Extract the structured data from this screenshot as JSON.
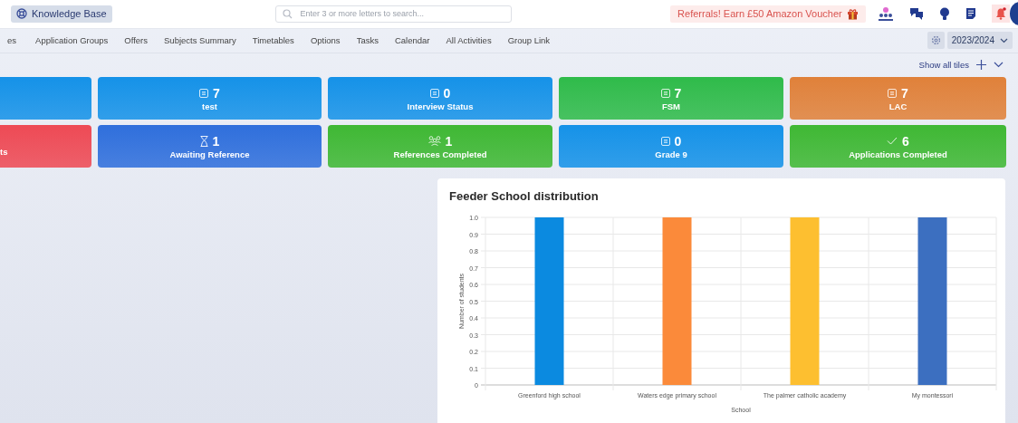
{
  "header": {
    "knowledge_base": "Knowledge Base",
    "search": {
      "placeholder": "Enter 3 or more letters to search..."
    },
    "referral": "Referrals! Earn £50 Amazon Voucher"
  },
  "nav": {
    "tabs": [
      {
        "label": "es"
      },
      {
        "label": "Application Groups"
      },
      {
        "label": "Offers"
      },
      {
        "label": "Subjects Summary"
      },
      {
        "label": "Timetables"
      },
      {
        "label": "Options"
      },
      {
        "label": "Tasks"
      },
      {
        "label": "Calendar"
      },
      {
        "label": "All Activities"
      },
      {
        "label": "Group Link"
      }
    ],
    "year": "2023/2024"
  },
  "show_all_tiles": "Show all tiles",
  "tiles": [
    {
      "kind": "cut",
      "color": "#1592e8"
    },
    {
      "kind": "list",
      "color": "#1592e8",
      "count": "7",
      "label": "test"
    },
    {
      "kind": "list",
      "color": "#1592e8",
      "count": "0",
      "label": "Interview Status"
    },
    {
      "kind": "list",
      "color": "#2fbb4a",
      "count": "7",
      "label": "FSM"
    },
    {
      "kind": "list",
      "color": "#e0813a",
      "count": "7",
      "label": "LAC"
    },
    {
      "kind": "cut",
      "color": "#ee4a55",
      "label": "ts"
    },
    {
      "kind": "hourglass",
      "color": "#2f6fdc",
      "count": "1",
      "label": "Awaiting Reference"
    },
    {
      "kind": "people",
      "color": "#3fb834",
      "count": "1",
      "label": "References Completed"
    },
    {
      "kind": "list",
      "color": "#1592e8",
      "count": "0",
      "label": "Grade 9"
    },
    {
      "kind": "check",
      "color": "#3fb834",
      "count": "6",
      "label": "Applications Completed"
    }
  ],
  "chart_card": {
    "title": "Feeder School distribution",
    "chart_data": {
      "type": "bar",
      "xlabel": "School",
      "ylabel": "Number of students",
      "categories": [
        "Greenford high school",
        "Waters edge primary school",
        "The palmer catholic academy",
        "My montessori"
      ],
      "stacked": true,
      "grid": true,
      "series": [
        {
          "color": "#0b8ae0",
          "values": [
            1,
            null,
            null,
            null
          ]
        },
        {
          "color": "#fb8a3a",
          "values": [
            null,
            1,
            null,
            null
          ]
        },
        {
          "color": "#fdbf30",
          "values": [
            null,
            null,
            1,
            null
          ]
        },
        {
          "color": "#3c6fc0",
          "values": [
            null,
            null,
            null,
            1
          ]
        }
      ],
      "ylim": [
        0,
        1
      ],
      "yticks": [
        0,
        {
          "value": 0.1,
          "label": "0.1"
        },
        {
          "value": 0.2,
          "label": "0.2"
        },
        {
          "value": 0.3,
          "label": "0.3"
        },
        {
          "value": 0.4,
          "label": "0.4"
        },
        {
          "value": 0.5,
          "label": "0.5"
        },
        {
          "value": 0.6,
          "label": "0.6"
        },
        {
          "value": 0.7,
          "label": "0.7"
        },
        {
          "value": 0.8,
          "label": "0.8"
        },
        {
          "value": 0.9,
          "label": "0.9"
        },
        {
          "value": 1,
          "label": "1.0"
        }
      ]
    }
  }
}
